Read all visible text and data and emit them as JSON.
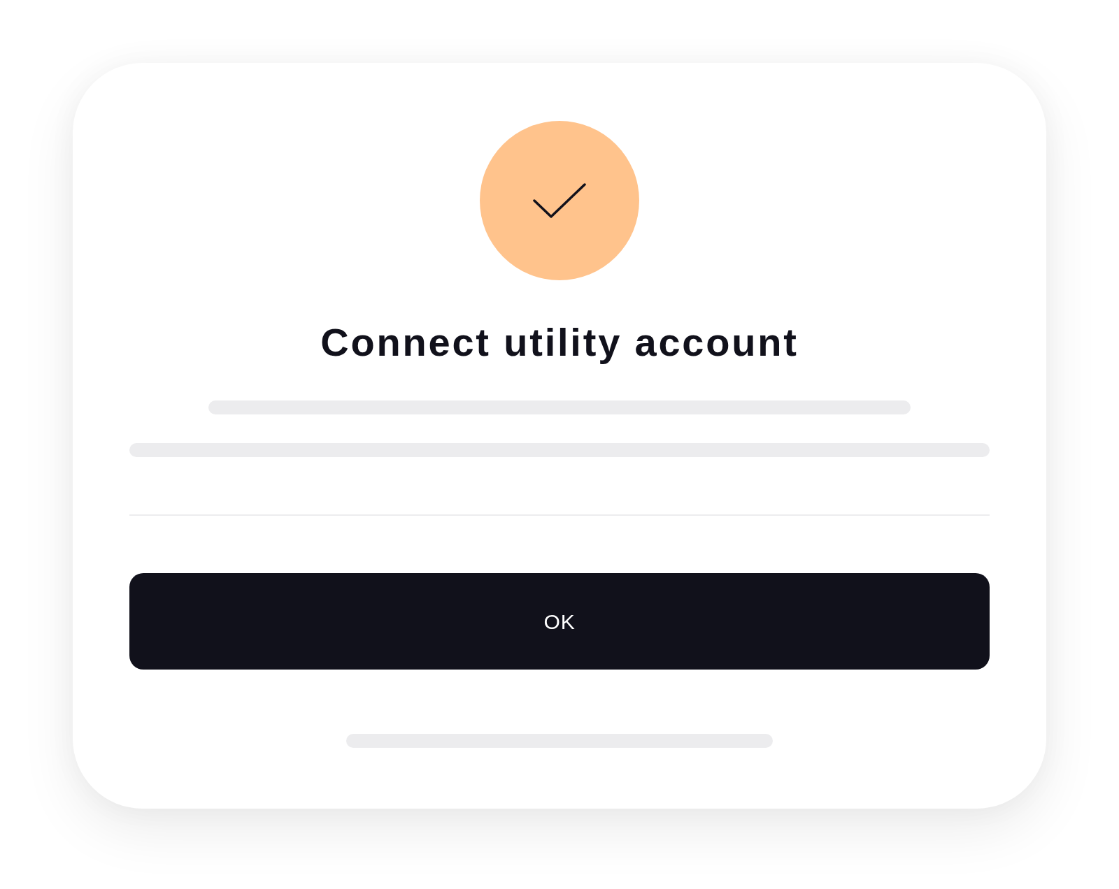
{
  "dialog": {
    "title": "Connect utility account",
    "button": "OK"
  }
}
